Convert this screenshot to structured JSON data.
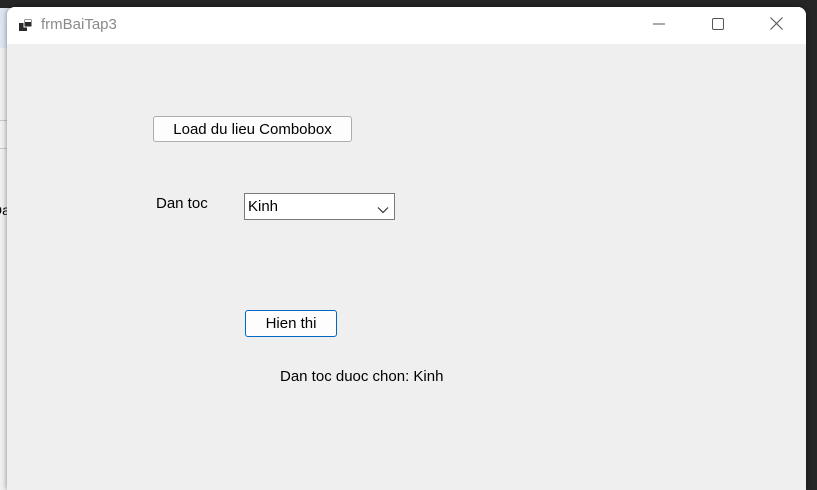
{
  "background_window": {
    "partial_text": "Da"
  },
  "window": {
    "title": "frmBaiTap3",
    "icons": {
      "app": "app-window-icon",
      "minimize": "minimize-icon",
      "maximize": "maximize-icon",
      "close": "close-icon"
    }
  },
  "form": {
    "load_button_label": "Load du lieu Combobox",
    "dantoc_label": "Dan toc",
    "combobox": {
      "selected_value": "Kinh",
      "arrow_icon": "chevron-down-icon"
    },
    "show_button_label": "Hien thi",
    "result_text": "Dan toc duoc chon: Kinh"
  },
  "colors": {
    "window_bg": "#efefef",
    "titlebar_bg": "#ffffff",
    "accent_border": "#0067c0"
  }
}
